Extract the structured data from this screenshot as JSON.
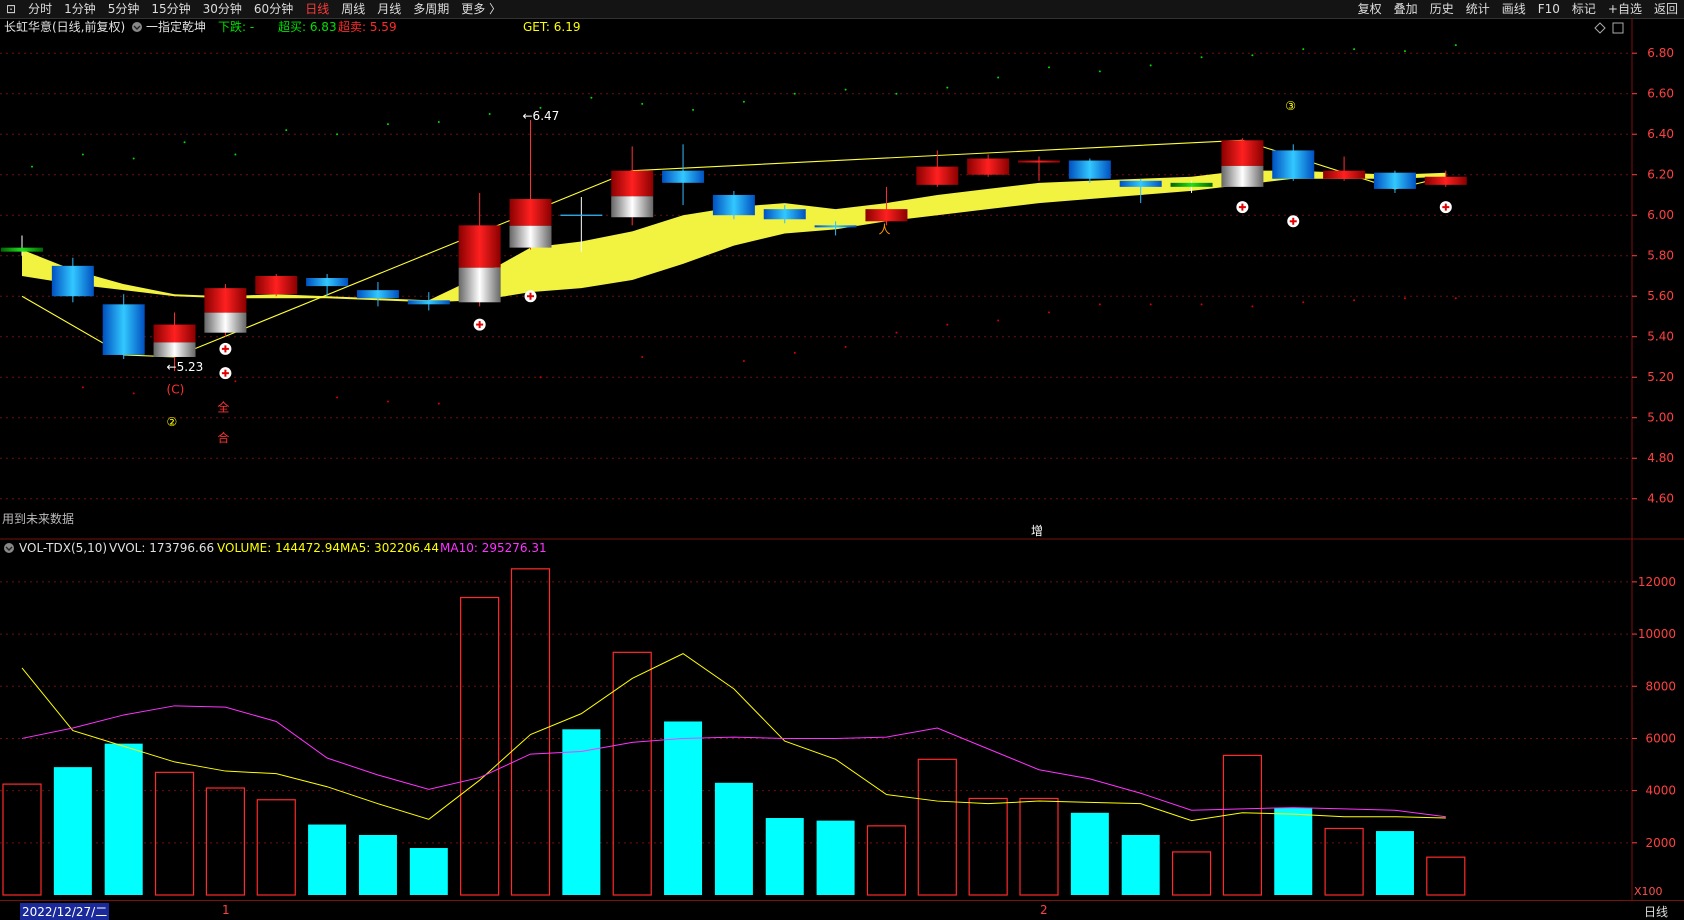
{
  "toolbar": {
    "left": [
      "分时",
      "1分钟",
      "5分钟",
      "15分钟",
      "30分钟",
      "60分钟",
      "日线",
      "周线",
      "月线",
      "多周期",
      "更多 〉"
    ],
    "active": "日线",
    "right": [
      "复权",
      "叠加",
      "历史",
      "统计",
      "画线",
      "F10",
      "标记",
      "+自选",
      "返回"
    ]
  },
  "header": {
    "stock": "长虹华意(日线,前复权)",
    "indicator": "一指定乾坤",
    "down_label": "下跌: -",
    "oversold_label": "超买: 6.83",
    "overbought_label": "超卖: 5.59",
    "get_label": "GET: 6.19"
  },
  "note_future": "用到未来数据",
  "zeng_label": "增",
  "vol_header": {
    "name": "VOL-TDX(5,10)",
    "vvol": "VVOL: 173796.66",
    "volume": "VOLUME: 144472.94",
    "ma5": "MA5: 302206.44",
    "ma10": "MA10: 295276.31"
  },
  "x100": "X100",
  "status": {
    "date": "2022/12/27/二",
    "mark1": "1",
    "mark2": "2",
    "period": "日线"
  },
  "colors": {
    "up": "#ff2a2a",
    "down": "#00ffff",
    "ma5": "#ffff00",
    "ma10": "#ff33ff",
    "band": "#ffff44",
    "axis": "#ff4040",
    "grid": "#6a1010"
  },
  "chart_data": [
    {
      "type": "candlestick",
      "title": "长虹华意(日线,前复权)",
      "y_ticks": [
        4.6,
        4.8,
        5.0,
        5.2,
        5.4,
        5.6,
        5.8,
        6.0,
        6.2,
        6.4,
        6.6,
        6.8
      ],
      "ylim": [
        4.5,
        6.88
      ],
      "candles": [
        {
          "o": 5.82,
          "c": 5.83,
          "h": 5.9,
          "l": 5.8,
          "dir": "flat"
        },
        {
          "o": 5.75,
          "c": 5.6,
          "h": 5.79,
          "l": 5.57,
          "dir": "down"
        },
        {
          "o": 5.56,
          "c": 5.31,
          "h": 5.61,
          "l": 5.29,
          "dir": "down"
        },
        {
          "o": 5.3,
          "c": 5.46,
          "h": 5.52,
          "l": 5.23,
          "dir": "up"
        },
        {
          "o": 5.42,
          "c": 5.64,
          "h": 5.66,
          "l": 5.4,
          "dir": "up"
        },
        {
          "o": 5.61,
          "c": 5.7,
          "h": 5.71,
          "l": 5.6,
          "dir": "up"
        },
        {
          "o": 5.69,
          "c": 5.65,
          "h": 5.71,
          "l": 5.6,
          "dir": "down"
        },
        {
          "o": 5.63,
          "c": 5.59,
          "h": 5.67,
          "l": 5.55,
          "dir": "down"
        },
        {
          "o": 5.58,
          "c": 5.56,
          "h": 5.62,
          "l": 5.53,
          "dir": "down"
        },
        {
          "o": 5.57,
          "c": 5.95,
          "h": 6.11,
          "l": 5.55,
          "dir": "up"
        },
        {
          "o": 5.84,
          "c": 6.08,
          "h": 6.47,
          "l": 5.83,
          "dir": "up"
        },
        {
          "o": 6.0,
          "c": 6.0,
          "h": 6.09,
          "l": 5.82,
          "dir": "cross"
        },
        {
          "o": 5.99,
          "c": 6.22,
          "h": 6.34,
          "l": 5.95,
          "dir": "up"
        },
        {
          "o": 6.22,
          "c": 6.16,
          "h": 6.35,
          "l": 6.05,
          "dir": "down"
        },
        {
          "o": 6.1,
          "c": 6.0,
          "h": 6.12,
          "l": 5.98,
          "dir": "down"
        },
        {
          "o": 6.03,
          "c": 5.98,
          "h": 6.05,
          "l": 5.96,
          "dir": "down"
        },
        {
          "o": 5.95,
          "c": 5.94,
          "h": 5.97,
          "l": 5.9,
          "dir": "down"
        },
        {
          "o": 5.97,
          "c": 6.03,
          "h": 6.14,
          "l": 5.95,
          "dir": "up"
        },
        {
          "o": 6.15,
          "c": 6.24,
          "h": 6.32,
          "l": 6.14,
          "dir": "up"
        },
        {
          "o": 6.2,
          "c": 6.28,
          "h": 6.3,
          "l": 6.19,
          "dir": "up"
        },
        {
          "o": 6.26,
          "c": 6.27,
          "h": 6.29,
          "l": 6.17,
          "dir": "up"
        },
        {
          "o": 6.27,
          "c": 6.18,
          "h": 6.28,
          "l": 6.16,
          "dir": "down"
        },
        {
          "o": 6.17,
          "c": 6.14,
          "h": 6.18,
          "l": 6.06,
          "dir": "down"
        },
        {
          "o": 6.15,
          "c": 6.14,
          "h": 6.17,
          "l": 6.11,
          "dir": "flat"
        },
        {
          "o": 6.14,
          "c": 6.37,
          "h": 6.38,
          "l": 6.14,
          "dir": "up"
        },
        {
          "o": 6.32,
          "c": 6.18,
          "h": 6.35,
          "l": 6.17,
          "dir": "down"
        },
        {
          "o": 6.18,
          "c": 6.22,
          "h": 6.29,
          "l": 6.17,
          "dir": "up"
        },
        {
          "o": 6.21,
          "c": 6.13,
          "h": 6.22,
          "l": 6.11,
          "dir": "down"
        },
        {
          "o": 6.15,
          "c": 6.19,
          "h": 6.22,
          "l": 6.14,
          "dir": "up"
        }
      ],
      "zigzag": [
        [
          0,
          5.6
        ],
        [
          2,
          5.31
        ],
        [
          3,
          5.3
        ],
        [
          12,
          6.22
        ],
        [
          24,
          6.37
        ],
        [
          27,
          6.13
        ],
        [
          28,
          6.19
        ]
      ],
      "band_top": [
        5.83,
        5.73,
        5.66,
        5.61,
        5.6,
        5.61,
        5.6,
        5.59,
        5.58,
        5.7,
        5.84,
        5.87,
        5.92,
        6.0,
        6.04,
        6.06,
        6.03,
        6.06,
        6.1,
        6.13,
        6.16,
        6.17,
        6.18,
        6.19,
        6.22,
        6.22,
        6.21,
        6.2,
        6.21
      ],
      "band_bottom": [
        5.7,
        5.66,
        5.63,
        5.6,
        5.59,
        5.59,
        5.59,
        5.58,
        5.57,
        5.58,
        5.62,
        5.64,
        5.68,
        5.76,
        5.85,
        5.91,
        5.93,
        5.97,
        6.0,
        6.03,
        6.06,
        6.08,
        6.1,
        6.12,
        6.15,
        6.18,
        6.18,
        6.18,
        6.19
      ],
      "annotations": [
        {
          "i": 3,
          "price": 5.23,
          "text": "←5.23",
          "color": "#ffffff"
        },
        {
          "i": 10,
          "price": 6.47,
          "text": "←6.47",
          "color": "#ffffff"
        },
        {
          "i": 3,
          "price": 5.12,
          "text": "(C)",
          "color": "#ff3030"
        },
        {
          "i": 3,
          "price": 4.96,
          "text": "②",
          "color": "#ffff00"
        },
        {
          "i": 4,
          "price": 5.03,
          "text": "全",
          "color": "#ff3030"
        },
        {
          "i": 4,
          "price": 4.88,
          "text": "合",
          "color": "#ff3030"
        },
        {
          "i": 25,
          "price": 6.52,
          "text": "③",
          "color": "#ffff00"
        },
        {
          "i": 17,
          "price": 5.91,
          "text": "人",
          "color": "#ff9900"
        }
      ],
      "plus_markers": [
        {
          "i": 4,
          "price": 5.34
        },
        {
          "i": 4,
          "price": 5.22
        },
        {
          "i": 9,
          "price": 5.46
        },
        {
          "i": 10,
          "price": 5.6
        },
        {
          "i": 24,
          "price": 6.04
        },
        {
          "i": 25,
          "price": 5.97
        },
        {
          "i": 28,
          "price": 6.04
        }
      ],
      "green_dots": [
        [
          0,
          6.24
        ],
        [
          1,
          6.3
        ],
        [
          2,
          6.28
        ],
        [
          3,
          6.36
        ],
        [
          4,
          6.3
        ],
        [
          5,
          6.42
        ],
        [
          6,
          6.4
        ],
        [
          7,
          6.45
        ],
        [
          8,
          6.46
        ],
        [
          9,
          6.5
        ],
        [
          10,
          6.53
        ],
        [
          11,
          6.58
        ],
        [
          12,
          6.55
        ],
        [
          13,
          6.52
        ],
        [
          14,
          6.56
        ],
        [
          15,
          6.6
        ],
        [
          16,
          6.62
        ],
        [
          17,
          6.6
        ],
        [
          18,
          6.63
        ],
        [
          19,
          6.68
        ],
        [
          20,
          6.73
        ],
        [
          21,
          6.71
        ],
        [
          22,
          6.74
        ],
        [
          23,
          6.78
        ],
        [
          24,
          6.79
        ],
        [
          25,
          6.82
        ],
        [
          26,
          6.82
        ],
        [
          27,
          6.81
        ],
        [
          28,
          6.84
        ]
      ],
      "red_dots": [
        [
          1,
          5.15
        ],
        [
          2,
          5.12
        ],
        [
          4,
          5.18
        ],
        [
          6,
          5.1
        ],
        [
          7,
          5.08
        ],
        [
          8,
          5.07
        ],
        [
          10,
          5.2
        ],
        [
          12,
          5.3
        ],
        [
          14,
          5.28
        ],
        [
          15,
          5.32
        ],
        [
          16,
          5.35
        ],
        [
          17,
          5.42
        ],
        [
          18,
          5.46
        ],
        [
          19,
          5.48
        ],
        [
          20,
          5.52
        ],
        [
          21,
          5.56
        ],
        [
          22,
          5.56
        ],
        [
          23,
          5.56
        ],
        [
          24,
          5.55
        ],
        [
          25,
          5.57
        ],
        [
          26,
          5.58
        ],
        [
          27,
          5.59
        ],
        [
          28,
          5.59
        ]
      ]
    },
    {
      "type": "bar",
      "title": "VOL-TDX(5,10)",
      "unit_label": "X100",
      "y_ticks": [
        2000,
        4000,
        6000,
        8000,
        10000,
        12000
      ],
      "ylim": [
        0,
        12800
      ],
      "values": [
        4250,
        4900,
        5800,
        4700,
        4100,
        3650,
        2700,
        2300,
        1800,
        11400,
        12500,
        6350,
        9300,
        6650,
        4300,
        2950,
        2850,
        2650,
        5200,
        3700,
        3700,
        3150,
        2300,
        1650,
        5350,
        3350,
        2550,
        2450,
        1450
      ],
      "dirs": [
        "up",
        "down",
        "down",
        "up",
        "up",
        "up",
        "down",
        "down",
        "down",
        "up",
        "up",
        "down",
        "up",
        "down",
        "down",
        "down",
        "down",
        "up",
        "up",
        "up",
        "up",
        "down",
        "down",
        "up",
        "up",
        "down",
        "up",
        "down",
        "up"
      ],
      "ma5": [
        8700,
        6300,
        5700,
        5100,
        4750,
        4650,
        4150,
        3500,
        2900,
        4400,
        6150,
        6950,
        8300,
        9250,
        7900,
        5900,
        5200,
        3850,
        3600,
        3500,
        3600,
        3550,
        3500,
        2850,
        3150,
        3100,
        3000,
        3000,
        2950
      ],
      "ma10": [
        6000,
        6400,
        6900,
        7250,
        7200,
        6650,
        5250,
        4600,
        4050,
        4500,
        5400,
        5500,
        5850,
        6000,
        6050,
        6000,
        6000,
        6050,
        6400,
        5600,
        4800,
        4450,
        3900,
        3250,
        3300,
        3350,
        3300,
        3250,
        3000
      ]
    }
  ]
}
